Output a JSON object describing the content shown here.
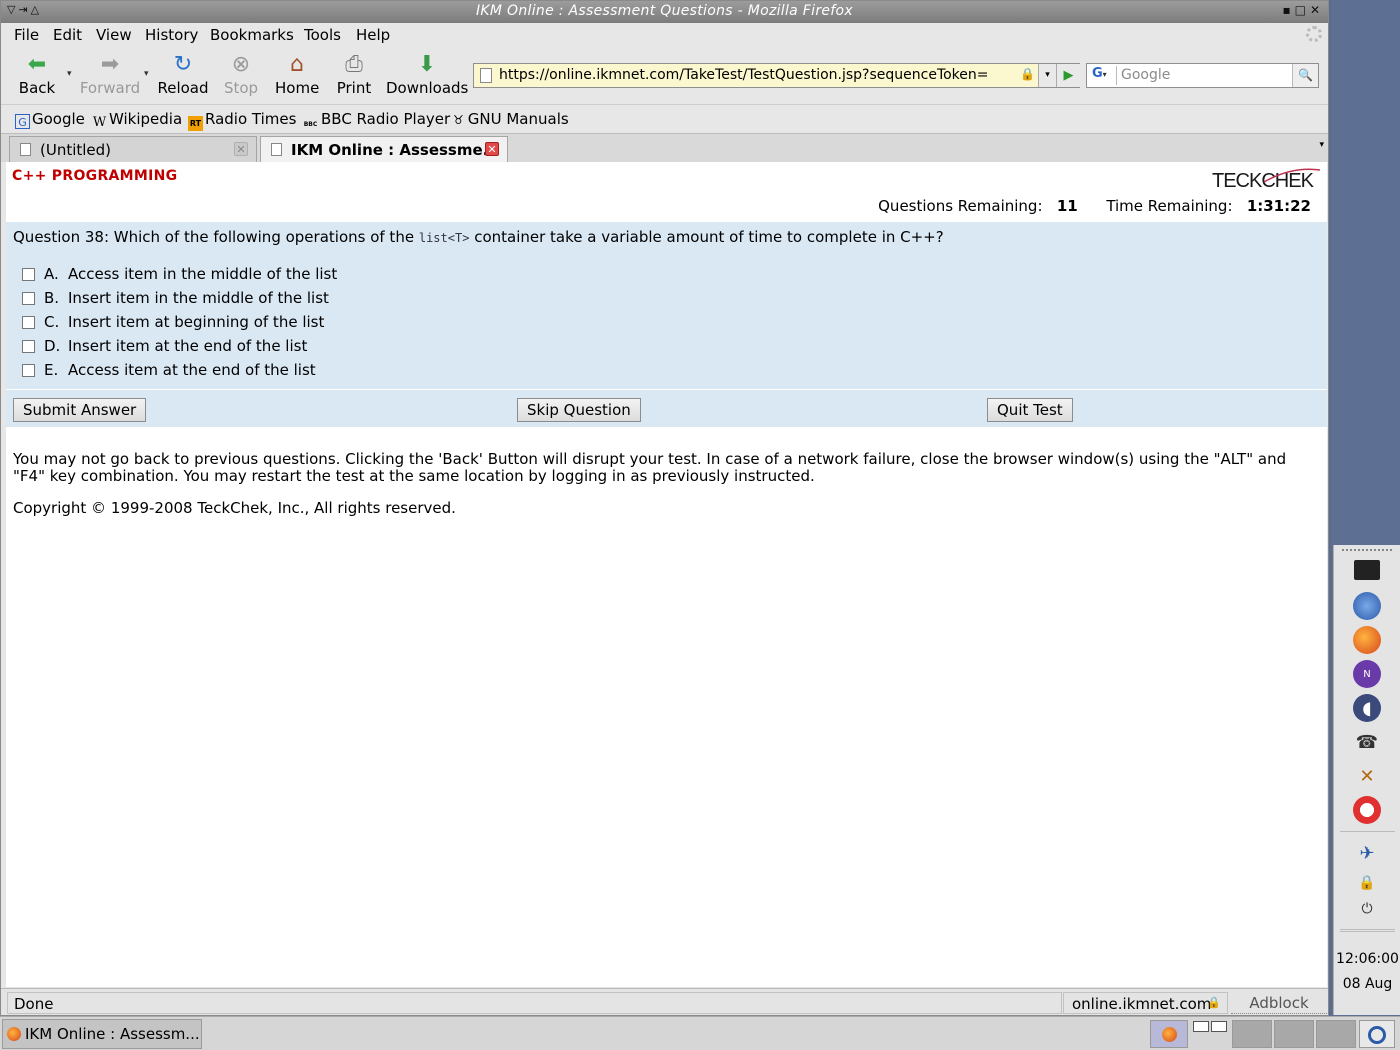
{
  "window": {
    "title": "IKM Online : Assessment Questions - Mozilla Firefox"
  },
  "menu": {
    "file": "File",
    "edit": "Edit",
    "view": "View",
    "history": "History",
    "bookmarks": "Bookmarks",
    "tools": "Tools",
    "help": "Help"
  },
  "nav": {
    "back": "Back",
    "forward": "Forward",
    "reload": "Reload",
    "stop": "Stop",
    "home": "Home",
    "print": "Print",
    "downloads": "Downloads",
    "url": "https://online.ikmnet.com/TakeTest/TestQuestion.jsp?sequenceToken=",
    "search_placeholder": "Google",
    "search_engine_glyph": "G"
  },
  "bookmarks": [
    {
      "label": "Google",
      "icon": "G"
    },
    {
      "label": "Wikipedia",
      "icon": "W"
    },
    {
      "label": "Radio Times",
      "icon": "RT"
    },
    {
      "label": "BBC Radio Player",
      "icon": "BBC"
    },
    {
      "label": "GNU Manuals",
      "icon": "gnu"
    }
  ],
  "tabs": [
    {
      "label": "(Untitled)",
      "active": false
    },
    {
      "label": "IKM Online : Assessme...",
      "active": true
    }
  ],
  "page": {
    "subject": "C++ PROGRAMMING",
    "logo_text": "TECKCHEK",
    "questions_remaining_label": "Questions Remaining:",
    "questions_remaining_value": "11",
    "time_remaining_label": "Time Remaining:",
    "time_remaining_value": "1:31:22",
    "question_prefix": "Question 38: Which of the following operations of the",
    "question_code": "list<T>",
    "question_suffix": "container take a variable amount of time to complete in C++?",
    "options": [
      {
        "key": "A.",
        "text": "Access item in the middle of the list"
      },
      {
        "key": "B.",
        "text": "Insert item in the middle of the list"
      },
      {
        "key": "C.",
        "text": "Insert item at beginning of the list"
      },
      {
        "key": "D.",
        "text": "Insert item at the end of the list"
      },
      {
        "key": "E.",
        "text": "Access  item at the end of the list"
      }
    ],
    "submit_button": "Submit Answer",
    "skip_button": "Skip Question",
    "quit_button": "Quit Test",
    "notice": "You may not go back to previous questions. Clicking the 'Back' Button will disrupt your test. In case of a network failure, close the browser window(s) using the \"ALT\" and \"F4\" key combination. You may restart the test at the same location by logging in as previously instructed.",
    "copyright": "Copyright © 1999-2008 TeckChek, Inc., All rights reserved."
  },
  "status": {
    "text": "Done",
    "host": "online.ikmnet.com",
    "adblock": "Adblock"
  },
  "taskbar": {
    "task_label": "IKM Online : Assessm..."
  },
  "clock": {
    "time": "12:06:00",
    "date": "08 Aug"
  },
  "colors": {
    "subject_red": "#c00000",
    "question_panel": "#dae8f4",
    "url_bar_secure": "#fbf8cf"
  }
}
